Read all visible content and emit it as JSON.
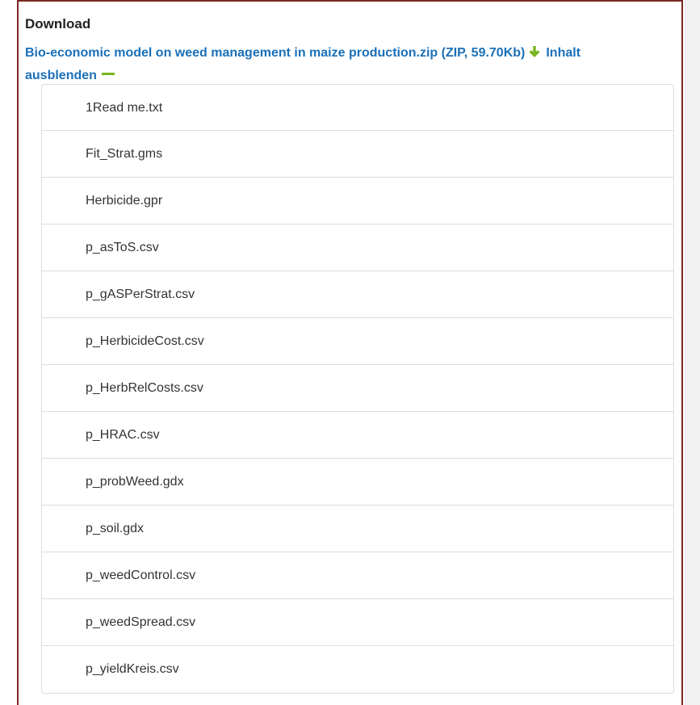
{
  "section": {
    "heading": "Download",
    "file_link_name": "Bio-economic model on weed management in maize production.zip (ZIP, 59.70Kb)",
    "toggle_label": "Inhalt ausblenden",
    "icons": {
      "download": "download-arrow-icon",
      "collapse": "minus-icon"
    },
    "colors": {
      "link": "#1a70b8",
      "icon_green": "#7ab51d",
      "frame": "#7a2a22"
    }
  },
  "files": [
    "1Read me.txt",
    "Fit_Strat.gms",
    "Herbicide.gpr",
    "p_asToS.csv",
    "p_gASPerStrat.csv",
    "p_HerbicideCost.csv",
    "p_HerbRelCosts.csv",
    "p_HRAC.csv",
    "p_probWeed.gdx",
    "p_soil.gdx",
    "p_weedControl.csv",
    "p_weedSpread.csv",
    "p_yieldKreis.csv"
  ]
}
